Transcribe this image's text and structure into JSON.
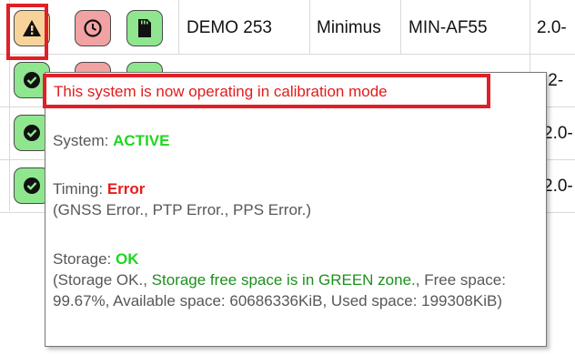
{
  "table": {
    "row": {
      "name": "DEMO 253",
      "model": "Minimus",
      "code": "MIN-AF55",
      "version": "2.0-"
    },
    "partial_versions": [
      ".2-",
      "2.0-",
      "2.0-"
    ]
  },
  "icons": {
    "warning": "warning-triangle-icon",
    "clock": "clock-icon",
    "sd_card": "sd-card-icon",
    "check": "check-circle-icon"
  },
  "colors": {
    "warn_bg": "#f7d39a",
    "red_bg": "#f2a2a2",
    "green_bg": "#8fe68f",
    "highlight": "#e01f26",
    "ok_green": "#20d620",
    "error_red": "#e81c1c"
  },
  "tooltip": {
    "calibration": "This system is now operating in calibration mode",
    "system_label": "System: ",
    "system_value": "ACTIVE",
    "timing_label": "Timing: ",
    "timing_value": "Error",
    "timing_detail": "(GNSS Error., PTP Error., PPS Error.)",
    "storage_label": "Storage: ",
    "storage_value": "OK",
    "storage_detail_open": "(Storage OK., ",
    "storage_detail_green": "Storage free space is in GREEN zone.",
    "storage_detail_rest": ", Free space: 99.67%, Available space: 60686336KiB, Used space: 199308KiB)"
  }
}
